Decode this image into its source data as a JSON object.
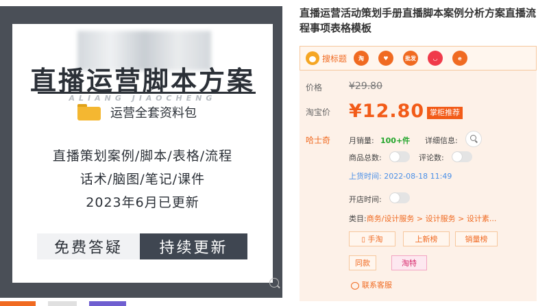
{
  "image": {
    "blurred_brand_watermark": "ALIANG JIAOCHENG",
    "banner_title": "直播运营脚本方案",
    "folder_label": "运营全套资料包",
    "body_lines": [
      "直播策划案例/脚本/表格/流程",
      "话术/脑图/笔记/课件",
      "2023年6月已更新"
    ],
    "cta_left": "免费答疑",
    "cta_right": "持续更新"
  },
  "product": {
    "title": "直播运营活动策划手册直播脚本案例分析方案直播流程事项表格模板"
  },
  "source": {
    "label": "搜标题",
    "buttons": [
      {
        "name": "taobao-icon",
        "text": "淘",
        "color": "#f06a21"
      },
      {
        "name": "heart-icon",
        "text": "♥",
        "color": "#f06a21"
      },
      {
        "name": "pifa-icon",
        "text": "批发",
        "color": "#f06a21"
      },
      {
        "name": "smile-icon",
        "text": "◡",
        "color": "#f03a4a"
      },
      {
        "name": "swirl-icon",
        "text": "e",
        "color": "#f06a21"
      }
    ]
  },
  "price": {
    "old_label": "价格",
    "old_value": "¥29.80",
    "taobao_label": "淘宝价",
    "taobao_value": "¥12.80",
    "recommend": "掌柜推荐"
  },
  "shop": {
    "name": "哈士奇",
    "monthly_sales_label": "月销量:",
    "monthly_sales_value": "100+件",
    "detail_label": "详细信息:",
    "total_products_label": "商品总数:",
    "reviews_label": "评论数:",
    "listing_time": "上货时间: 2022-08-18 11:49",
    "open_time_label": "开店时间:",
    "category_label": "类目:",
    "category_value": "商务/设计服务 > 设计服务 > 设计素..."
  },
  "actions": {
    "mobile_taobao": "手淘",
    "new_list": "上新榜",
    "sales_list": "销量榜",
    "same_style": "同款",
    "taote": "淘特",
    "contact": "联系客服"
  }
}
